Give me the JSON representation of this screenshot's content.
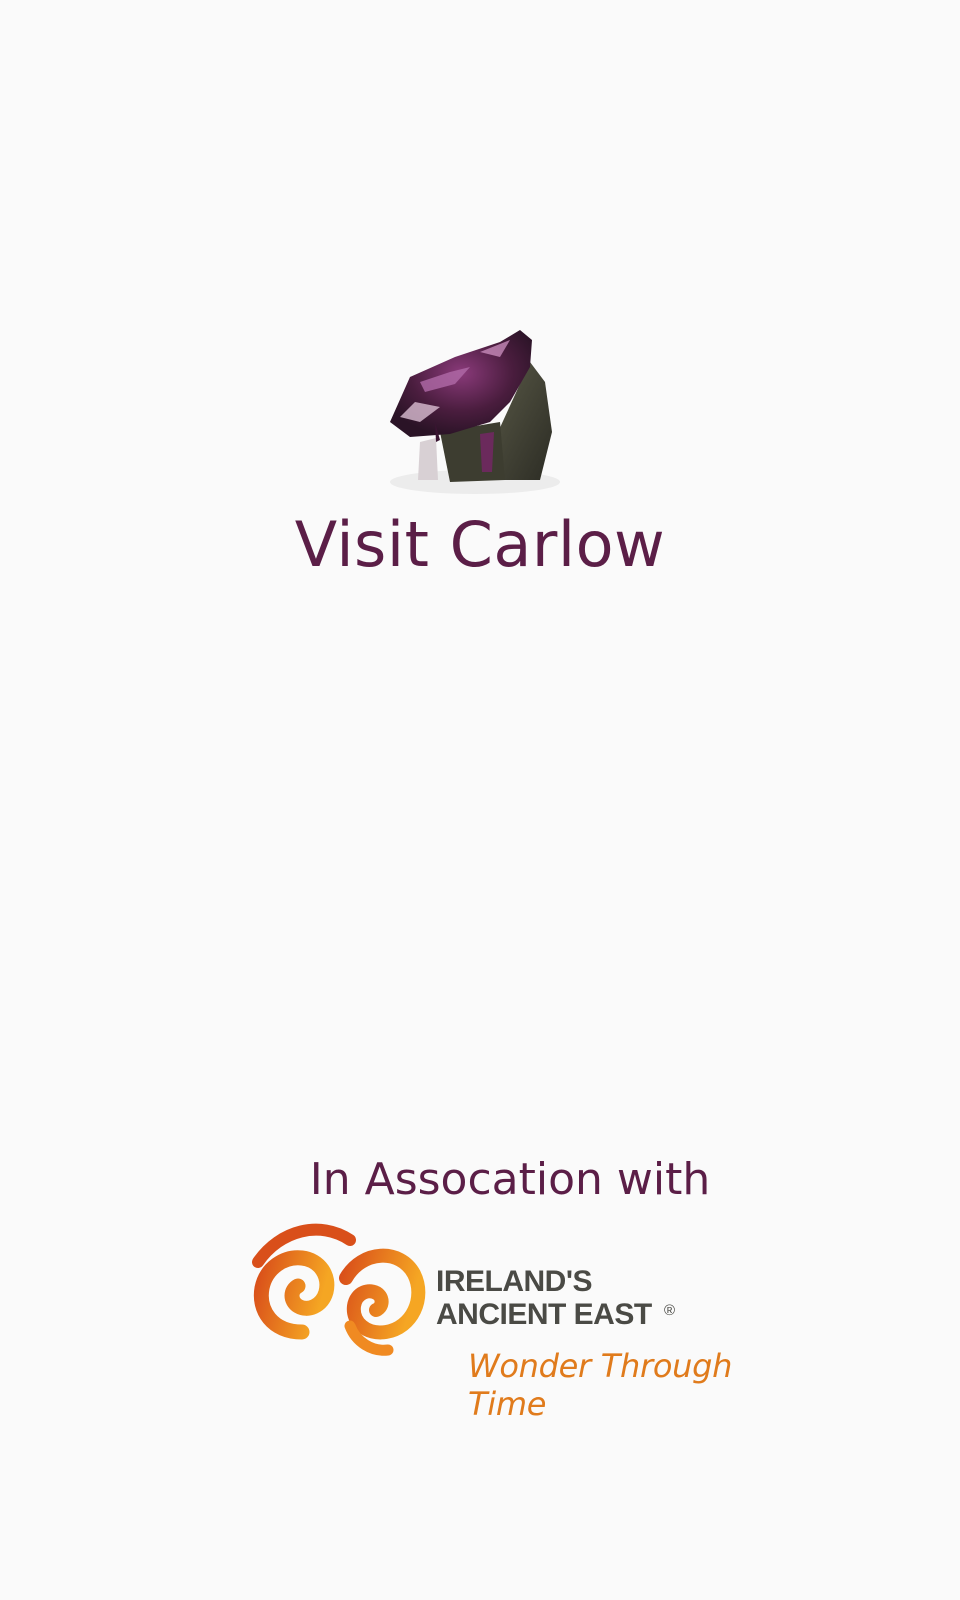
{
  "splash": {
    "app_title": "Visit Carlow",
    "association_text": "In Assocation with",
    "partner": {
      "line1": "IRELAND'S",
      "line2": "ANCIENT EAST",
      "registered": "®",
      "tagline": "Wonder Through Time"
    },
    "icons": {
      "app_logo": "dolmen-logo-icon",
      "partner_logo": "spiral-swirl-icon"
    }
  },
  "colors": {
    "background": "#fafafa",
    "title": "#5b1e47",
    "partner_text": "#4a4a45",
    "tagline": "#e07b1c",
    "swirl_start": "#d94f1a",
    "swirl_end": "#f5a623"
  }
}
